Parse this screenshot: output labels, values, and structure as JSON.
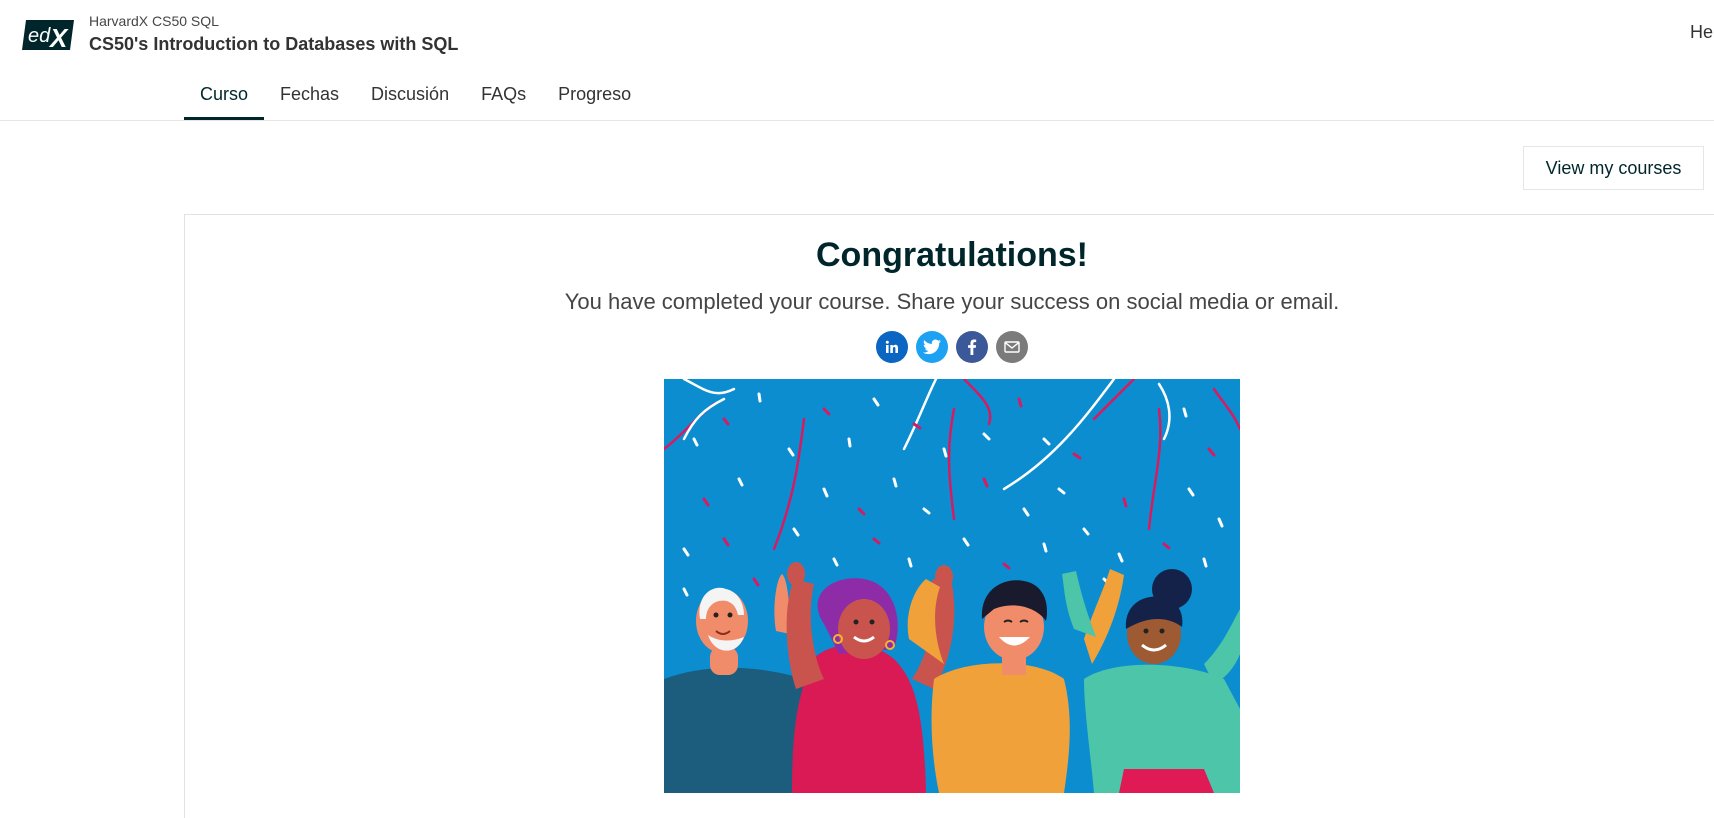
{
  "header": {
    "logo_alt": "edX",
    "org_line": "HarvardX CS50 SQL",
    "course_title": "CS50's Introduction to Databases with SQL",
    "right_text": "He"
  },
  "tabs": [
    {
      "label": "Curso",
      "active": true
    },
    {
      "label": "Fechas",
      "active": false
    },
    {
      "label": "Discusión",
      "active": false
    },
    {
      "label": "FAQs",
      "active": false
    },
    {
      "label": "Progreso",
      "active": false
    }
  ],
  "actions": {
    "view_courses_label": "View my courses"
  },
  "celebration": {
    "title": "Congratulations!",
    "subtitle": "You have completed your course. Share your success on social media or email.",
    "share_icons": [
      {
        "name": "linkedin-icon",
        "color": "#0a66c2"
      },
      {
        "name": "twitter-icon",
        "color": "#1da1f2"
      },
      {
        "name": "facebook-icon",
        "color": "#3b5998"
      },
      {
        "name": "email-icon",
        "color": "#7b7b7b"
      }
    ],
    "image_background": "#0b8dd0"
  },
  "colors": {
    "primary": "#00262b",
    "text": "#454545",
    "border": "#e6e6e6"
  }
}
